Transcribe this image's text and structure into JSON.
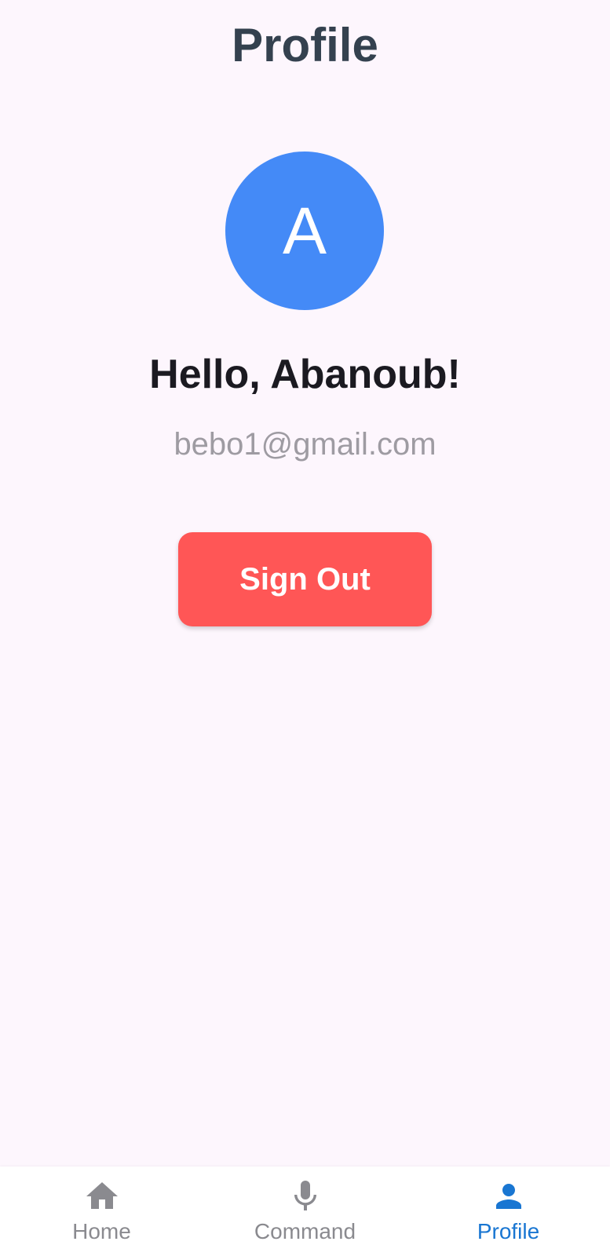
{
  "header": {
    "title": "Profile"
  },
  "profile": {
    "avatar_initial": "A",
    "greeting": "Hello, Abanoub!",
    "email": "bebo1@gmail.com"
  },
  "actions": {
    "signout_label": "Sign Out"
  },
  "bottom_nav": {
    "items": [
      {
        "label": "Home",
        "icon": "home-icon",
        "active": false
      },
      {
        "label": "Command",
        "icon": "microphone-icon",
        "active": false
      },
      {
        "label": "Profile",
        "icon": "person-icon",
        "active": true
      }
    ]
  },
  "colors": {
    "background": "#fdf6fd",
    "title": "#34414f",
    "avatar": "#448af7",
    "signout_button": "#ff5656",
    "nav_active": "#1976d2",
    "nav_inactive": "#8a8a8f"
  }
}
